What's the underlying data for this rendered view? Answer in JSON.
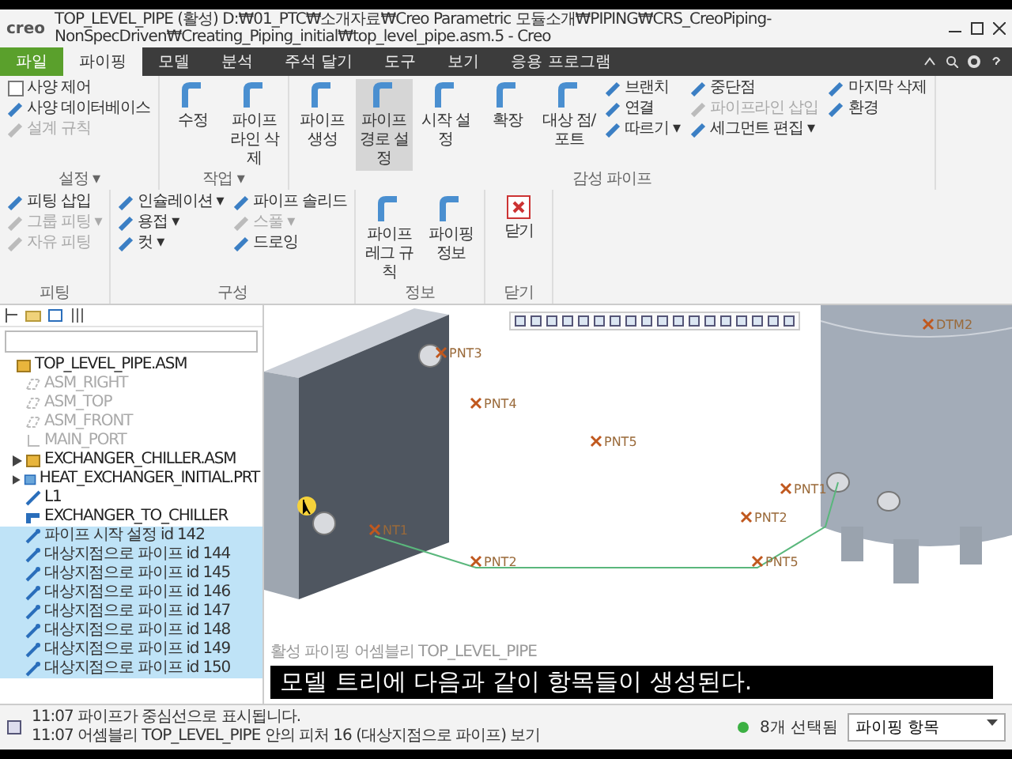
{
  "window": {
    "logo": "creo",
    "title": "TOP_LEVEL_PIPE (활성) D:₩01_PTC₩소개자료₩Creo Parametric 모듈소개₩PIPING₩CRS_CreoPiping-NonSpecDriven₩Creating_Piping_initial₩top_level_pipe.asm.5 - Creo"
  },
  "tabs": [
    {
      "label": "파일",
      "kind": "file",
      "selected": false
    },
    {
      "label": "파이핑",
      "kind": "tab",
      "selected": true
    },
    {
      "label": "모델",
      "kind": "tab",
      "selected": false
    },
    {
      "label": "분석",
      "kind": "tab",
      "selected": false
    },
    {
      "label": "주석 달기",
      "kind": "tab",
      "selected": false
    },
    {
      "label": "도구",
      "kind": "tab",
      "selected": false
    },
    {
      "label": "보기",
      "kind": "tab",
      "selected": false
    },
    {
      "label": "응용 프로그램",
      "kind": "tab",
      "selected": false
    }
  ],
  "ribbon": {
    "groups": [
      {
        "label": "설정 ▾",
        "columns": [
          [
            {
              "label": "사양 제어",
              "kind": "check",
              "checked": false,
              "disabled": false,
              "selected": false
            },
            {
              "label": "사양 데이터베이스",
              "kind": "small",
              "disabled": false,
              "selected": false
            },
            {
              "label": "설계 규칙",
              "kind": "small",
              "disabled": true,
              "selected": false
            }
          ]
        ]
      },
      {
        "label": "작업 ▾",
        "columns": [
          [
            {
              "label": "수정",
              "kind": "large",
              "disabled": false,
              "selected": false
            }
          ],
          [
            {
              "label": "파이프라인 삭제",
              "kind": "large",
              "disabled": false,
              "selected": false
            }
          ]
        ]
      },
      {
        "label": "감성 파이프",
        "columns": [
          [
            {
              "label": "파이프 생성",
              "kind": "large",
              "disabled": false,
              "selected": false
            }
          ],
          [
            {
              "label": "파이프 경로 설정",
              "kind": "large",
              "disabled": false,
              "selected": true
            }
          ],
          [
            {
              "label": "시작 설정",
              "kind": "large",
              "disabled": false,
              "selected": false
            }
          ],
          [
            {
              "label": "확장",
              "kind": "large",
              "disabled": false,
              "selected": false
            }
          ],
          [
            {
              "label": "대상 점/포트",
              "kind": "large",
              "disabled": false,
              "selected": false
            }
          ],
          [
            {
              "label": "브랜치",
              "kind": "small",
              "disabled": false,
              "selected": false
            },
            {
              "label": "연결",
              "kind": "small",
              "disabled": false,
              "selected": false
            },
            {
              "label": "따르기 ▾",
              "kind": "small",
              "disabled": false,
              "selected": false
            }
          ],
          [
            {
              "label": "중단점",
              "kind": "small",
              "disabled": false,
              "selected": false
            },
            {
              "label": "파이프라인 삽입",
              "kind": "small",
              "disabled": true,
              "selected": false
            },
            {
              "label": "세그먼트 편집 ▾",
              "kind": "small",
              "disabled": false,
              "selected": false
            }
          ],
          [
            {
              "label": "마지막 삭제",
              "kind": "small",
              "disabled": false,
              "selected": false
            },
            {
              "label": "환경",
              "kind": "small",
              "disabled": false,
              "selected": false
            }
          ]
        ]
      },
      {
        "label": "피팅",
        "columns": [
          [
            {
              "label": "피팅 삽입",
              "kind": "small",
              "disabled": false,
              "selected": false
            },
            {
              "label": "그룹 피팅 ▾",
              "kind": "small",
              "disabled": true,
              "selected": false
            },
            {
              "label": "자유 피팅",
              "kind": "small",
              "disabled": true,
              "selected": false
            }
          ]
        ]
      },
      {
        "label": "구성",
        "columns": [
          [
            {
              "label": "인슐레이션 ▾",
              "kind": "small",
              "disabled": false,
              "selected": false
            },
            {
              "label": "용접 ▾",
              "kind": "small",
              "disabled": false,
              "selected": false
            },
            {
              "label": "컷 ▾",
              "kind": "small",
              "disabled": false,
              "selected": false
            }
          ],
          [
            {
              "label": "파이프 솔리드",
              "kind": "small",
              "disabled": false,
              "selected": false
            },
            {
              "label": "스풀 ▾",
              "kind": "small",
              "disabled": true,
              "selected": false
            },
            {
              "label": "드로잉",
              "kind": "small",
              "disabled": false,
              "selected": false
            }
          ]
        ]
      },
      {
        "label": "정보",
        "columns": [
          [
            {
              "label": "파이프 레그 규칙",
              "kind": "large",
              "disabled": false,
              "selected": false
            }
          ],
          [
            {
              "label": "파이핑 정보",
              "kind": "large",
              "disabled": false,
              "selected": false
            }
          ]
        ]
      },
      {
        "label": "닫기",
        "columns": [
          [
            {
              "label": "닫기",
              "kind": "close",
              "disabled": false,
              "selected": false
            }
          ]
        ]
      }
    ]
  },
  "tree": {
    "items": [
      {
        "label": "TOP_LEVEL_PIPE.ASM",
        "kind": "assembly",
        "dimmed": false,
        "selected": false,
        "collapsed": false,
        "children": [
          {
            "label": "ASM_RIGHT",
            "kind": "plane",
            "dimmed": true,
            "selected": false,
            "collapsed": false
          },
          {
            "label": "ASM_TOP",
            "kind": "plane",
            "dimmed": true,
            "selected": false,
            "collapsed": false
          },
          {
            "label": "ASM_FRONT",
            "kind": "plane",
            "dimmed": true,
            "selected": false,
            "collapsed": false
          },
          {
            "label": "MAIN_PORT",
            "kind": "csys",
            "dimmed": true,
            "selected": false,
            "collapsed": false
          },
          {
            "label": "EXCHANGER_CHILLER.ASM",
            "kind": "assembly",
            "dimmed": false,
            "selected": false,
            "collapsed": true
          },
          {
            "label": "HEAT_EXCHANGER_INITIAL.PRT",
            "kind": "part",
            "dimmed": false,
            "selected": false,
            "collapsed": true
          },
          {
            "label": "L1",
            "kind": "line",
            "dimmed": false,
            "selected": false,
            "collapsed": false
          },
          {
            "label": "EXCHANGER_TO_CHILLER",
            "kind": "pipe",
            "dimmed": false,
            "selected": false,
            "collapsed": false
          },
          {
            "label": "파이프 시작 설정 id 142",
            "kind": "segment",
            "dimmed": false,
            "selected": true,
            "collapsed": false
          },
          {
            "label": "대상지점으로 파이프 id 144",
            "kind": "segment",
            "dimmed": false,
            "selected": true,
            "collapsed": false
          },
          {
            "label": "대상지점으로 파이프 id 145",
            "kind": "segment",
            "dimmed": false,
            "selected": true,
            "collapsed": false
          },
          {
            "label": "대상지점으로 파이프 id 146",
            "kind": "segment",
            "dimmed": false,
            "selected": true,
            "collapsed": false
          },
          {
            "label": "대상지점으로 파이프 id 147",
            "kind": "segment",
            "dimmed": false,
            "selected": true,
            "collapsed": false
          },
          {
            "label": "대상지점으로 파이프 id 148",
            "kind": "segment",
            "dimmed": false,
            "selected": true,
            "collapsed": false
          },
          {
            "label": "대상지점으로 파이프 id 149",
            "kind": "segment",
            "dimmed": false,
            "selected": true,
            "collapsed": false
          },
          {
            "label": "대상지점으로 파이프 id 150",
            "kind": "segment",
            "dimmed": false,
            "selected": true,
            "collapsed": false
          }
        ]
      }
    ]
  },
  "canvas": {
    "labels": [
      "PNT4",
      "PNT5",
      "PNT1",
      "PNT2",
      "PNT2",
      "PNT5",
      "NT1",
      "PNT3",
      "DTM2"
    ],
    "footer": "활성 파이핑 어셈블리 TOP_LEVEL_PIPE",
    "caption": "모델 트리에 다음과 같이 항목들이 생성된다."
  },
  "status": {
    "messages": [
      "11:07 파이프가 중심선으로 표시됩니다.",
      "11:07 어셈블리 TOP_LEVEL_PIPE 안의 피처 16 (대상지점으로 파이프) 보기"
    ],
    "selection": "8개 선택됨",
    "filter": "파이핑 항목"
  }
}
